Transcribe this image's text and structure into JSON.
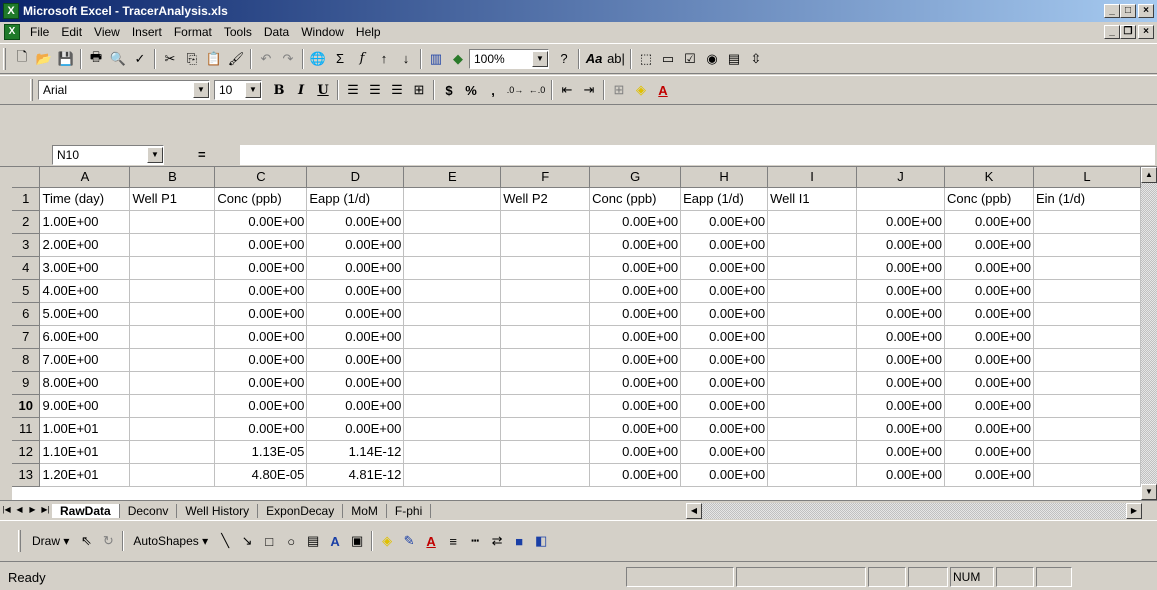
{
  "window": {
    "title": "Microsoft Excel - TracerAnalysis.xls"
  },
  "menu": [
    "File",
    "Edit",
    "View",
    "Insert",
    "Format",
    "Tools",
    "Data",
    "Window",
    "Help"
  ],
  "toolbar": {
    "zoom": "100%",
    "font_name": "Arial",
    "font_size": "10"
  },
  "formula_bar": {
    "name_box": "N10",
    "eq_sign": "="
  },
  "sheet": {
    "col_headers": [
      "A",
      "B",
      "C",
      "D",
      "E",
      "F",
      "G",
      "H",
      "I",
      "J",
      "K",
      "L"
    ],
    "rows": [
      {
        "num": "1",
        "cells": [
          "Time (day)",
          "Well P1",
          "Conc (ppb)",
          "Eapp (1/d)",
          "",
          "Well P2",
          "Conc (ppb)",
          "Eapp (1/d)",
          "Well I1",
          "",
          "Conc (ppb)",
          "Ein (1/d)"
        ]
      },
      {
        "num": "2",
        "cells": [
          "1.00E+00",
          "",
          "0.00E+00",
          "0.00E+00",
          "",
          "",
          "0.00E+00",
          "0.00E+00",
          "",
          "0.00E+00",
          "0.00E+00",
          ""
        ]
      },
      {
        "num": "3",
        "cells": [
          "2.00E+00",
          "",
          "0.00E+00",
          "0.00E+00",
          "",
          "",
          "0.00E+00",
          "0.00E+00",
          "",
          "0.00E+00",
          "0.00E+00",
          ""
        ]
      },
      {
        "num": "4",
        "cells": [
          "3.00E+00",
          "",
          "0.00E+00",
          "0.00E+00",
          "",
          "",
          "0.00E+00",
          "0.00E+00",
          "",
          "0.00E+00",
          "0.00E+00",
          ""
        ]
      },
      {
        "num": "5",
        "cells": [
          "4.00E+00",
          "",
          "0.00E+00",
          "0.00E+00",
          "",
          "",
          "0.00E+00",
          "0.00E+00",
          "",
          "0.00E+00",
          "0.00E+00",
          ""
        ]
      },
      {
        "num": "6",
        "cells": [
          "5.00E+00",
          "",
          "0.00E+00",
          "0.00E+00",
          "",
          "",
          "0.00E+00",
          "0.00E+00",
          "",
          "0.00E+00",
          "0.00E+00",
          ""
        ]
      },
      {
        "num": "7",
        "cells": [
          "6.00E+00",
          "",
          "0.00E+00",
          "0.00E+00",
          "",
          "",
          "0.00E+00",
          "0.00E+00",
          "",
          "0.00E+00",
          "0.00E+00",
          ""
        ]
      },
      {
        "num": "8",
        "cells": [
          "7.00E+00",
          "",
          "0.00E+00",
          "0.00E+00",
          "",
          "",
          "0.00E+00",
          "0.00E+00",
          "",
          "0.00E+00",
          "0.00E+00",
          ""
        ]
      },
      {
        "num": "9",
        "cells": [
          "8.00E+00",
          "",
          "0.00E+00",
          "0.00E+00",
          "",
          "",
          "0.00E+00",
          "0.00E+00",
          "",
          "0.00E+00",
          "0.00E+00",
          ""
        ]
      },
      {
        "num": "10",
        "cells": [
          "9.00E+00",
          "",
          "0.00E+00",
          "0.00E+00",
          "",
          "",
          "0.00E+00",
          "0.00E+00",
          "",
          "0.00E+00",
          "0.00E+00",
          ""
        ]
      },
      {
        "num": "11",
        "cells": [
          "1.00E+01",
          "",
          "0.00E+00",
          "0.00E+00",
          "",
          "",
          "0.00E+00",
          "0.00E+00",
          "",
          "0.00E+00",
          "0.00E+00",
          ""
        ]
      },
      {
        "num": "12",
        "cells": [
          "1.10E+01",
          "",
          "1.13E-05",
          "1.14E-12",
          "",
          "",
          "0.00E+00",
          "0.00E+00",
          "",
          "0.00E+00",
          "0.00E+00",
          ""
        ]
      },
      {
        "num": "13",
        "cells": [
          "1.20E+01",
          "",
          "4.80E-05",
          "4.81E-12",
          "",
          "",
          "0.00E+00",
          "0.00E+00",
          "",
          "0.00E+00",
          "0.00E+00",
          ""
        ]
      }
    ]
  },
  "sheet_tabs": [
    "RawData",
    "Deconv",
    "Well History",
    "ExponDecay",
    "MoM",
    "F-phi"
  ],
  "active_tab": "RawData",
  "drawing": {
    "draw_label": "Draw",
    "autoshapes_label": "AutoShapes"
  },
  "status": {
    "text": "Ready",
    "num_indicator": "NUM"
  }
}
